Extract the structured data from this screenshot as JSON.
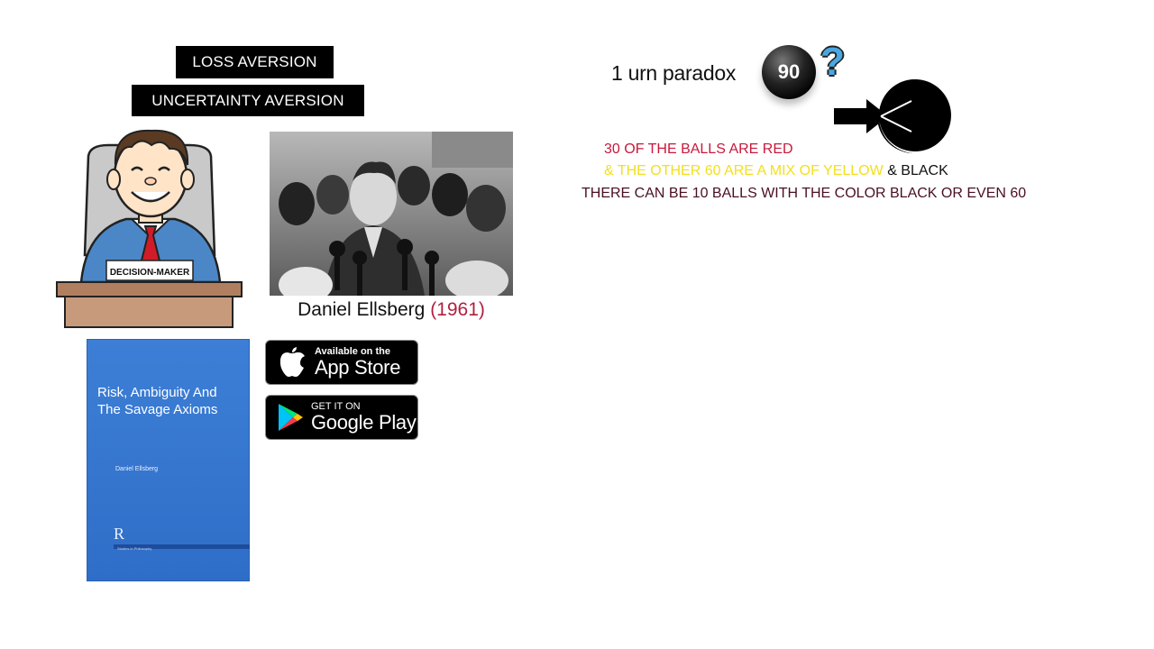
{
  "labels": {
    "loss_aversion": "LOSS AVERSION",
    "uncertainty_aversion": "UNCERTAINTY AVERSION"
  },
  "cartoon": {
    "nameplate": "DECISION-MAKER"
  },
  "photo": {
    "name": "Daniel Ellsberg",
    "year": "(1961)"
  },
  "book": {
    "title": "Risk, Ambiguity And The Savage Axioms",
    "author": "Daniel Ellsberg",
    "logo": "R",
    "series": "Studies in Philosophy"
  },
  "badges": {
    "appstore_small": "Available on the",
    "appstore_big": "App Store",
    "googleplay_small": "GET IT ON",
    "googleplay_big": "Google Play"
  },
  "urn": {
    "title": "1 urn paradox",
    "ball_number": "90",
    "question": "?",
    "line1": "30 OF THE BALLS ARE RED",
    "line2_yellow": "& THE OTHER 60 ARE A MIX OF YELLOW",
    "line2_black": "& BLACK",
    "line3": "THERE CAN BE 10 BALLS WITH THE COLOR BLACK OR EVEN 60"
  },
  "colors": {
    "red": "#c8193c",
    "yellow": "#f2e01c",
    "book_blue": "#3d7fd6",
    "question_blue": "#4aa8e0"
  }
}
